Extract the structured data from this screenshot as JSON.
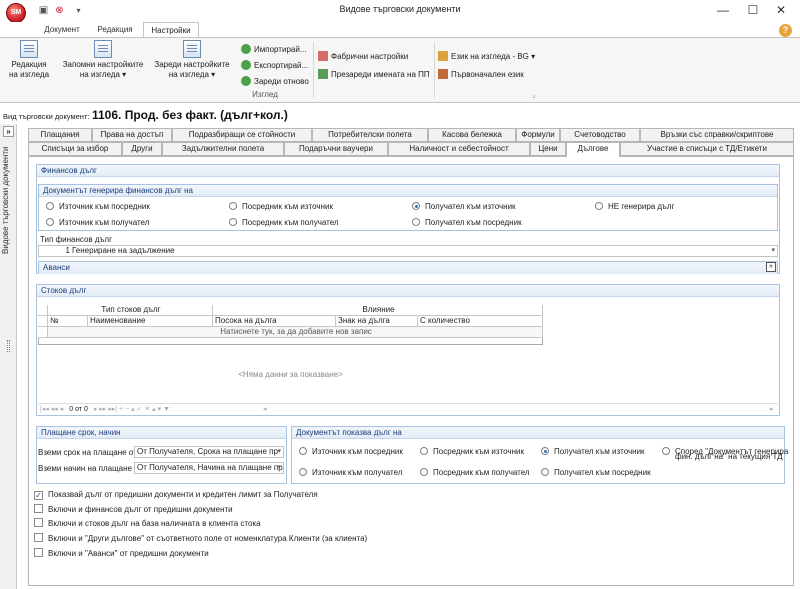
{
  "app": {
    "title": "Видове търговски документи",
    "orb_label": "SM"
  },
  "window": {
    "minimize": "—",
    "maximize": "☐",
    "close": "✕"
  },
  "ribbon": {
    "tabs": [
      "Документ",
      "Редакция",
      "Настройки"
    ],
    "active_tab": "Настройки",
    "buttons": {
      "edit_view": [
        "Редакция",
        "на изгледа"
      ],
      "save_settings": [
        "Запомни настройките",
        "на изгледа ▾"
      ],
      "load_settings": [
        "Зареди настройките",
        "на изгледа ▾"
      ],
      "import": "Импортирай...",
      "export": "Експортирай...",
      "reload": "Зареди отново",
      "factory": "Фабрични настройки",
      "reload_names": "Презареди имената на ПП",
      "language": "Език на изгледа - BG ▾",
      "original_language": "Първоначален език"
    },
    "group_label": "Изглед"
  },
  "doc": {
    "label": "Вид търговски документ:",
    "value": "1106. Прод. без факт. (дълг+кол.)"
  },
  "sidebar": {
    "label": "Видове търговски документи",
    "toggle": "»"
  },
  "tabs_row1": [
    "Плащания",
    "Права на достъп",
    "Подразбиращи се стойности",
    "Потребителски полета",
    "Касова бележка",
    "Формули",
    "Счетоводство",
    "Връзки със справки/скриптове"
  ],
  "tabs_row2": [
    "Списъци за избор",
    "Други",
    "Задължителни полета",
    "Подаръчни ваучери",
    "Наличност и себестойност",
    "Цени",
    "Дългове",
    "Участие в списъци с ТД/Етикети"
  ],
  "active_tab": "Дългове",
  "financial": {
    "title": "Финансов дълг",
    "source_title": "Документът генерира финансов дълг на",
    "options": [
      {
        "label": "Източник към посредник",
        "selected": false
      },
      {
        "label": "Посредник към източник",
        "selected": false
      },
      {
        "label": "Получател към източник",
        "selected": true
      },
      {
        "label": "НЕ генерира дълг",
        "selected": false
      },
      {
        "label": "Източник към получател",
        "selected": false
      },
      {
        "label": "Посредник към получател",
        "selected": false
      },
      {
        "label": "Получател към посредник",
        "selected": false
      }
    ],
    "type_label": "Тип финансов дълг",
    "type_num": "1",
    "type_value": "Генериране на задължение",
    "advances": "Аванси"
  },
  "stock": {
    "title": "Стоков дълг",
    "col_group1": "Тип стоков дълг",
    "col_group2": "Влияние",
    "cols": [
      "№",
      "Наименование",
      "Посока на дълга",
      "Знак на дълга",
      "С количество"
    ],
    "add_row": "Натиснете тук, за да добавите нов запис",
    "empty": "<Няма данни за показване>",
    "pager": "0 от 0"
  },
  "payment": {
    "title": "Плащане срок, начин",
    "term_label": "Вземи срок на плащане от",
    "term_value": "От Получателя, Срока на плащане пр",
    "method_label": "Вземи начин на плащане от",
    "method_value": "От Получателя, Начина на плащане пр"
  },
  "shows": {
    "title": "Документът показва дълг на",
    "options": [
      {
        "label": "Източник към посредник",
        "selected": false
      },
      {
        "label": "Посредник към източник",
        "selected": false
      },
      {
        "label": "Получател към източник",
        "selected": true
      },
      {
        "label": "Според \"Документът генерира",
        "label2": "фин. дълг на\" на текущия ТД",
        "selected": false
      },
      {
        "label": "Източник към получател",
        "selected": false
      },
      {
        "label": "Посредник към получател",
        "selected": false
      },
      {
        "label": "Получател към посредник",
        "selected": false
      }
    ]
  },
  "checkboxes": [
    {
      "label": "Показвай дълг от предишни документи и кредитен лимит за Получателя",
      "checked": true
    },
    {
      "label": "Включи и финансов дълг от предишни документи",
      "checked": false
    },
    {
      "label": "Включи и стоков дълг на база наличната в клиента стока",
      "checked": false
    },
    {
      "label": "Включи и \"Други дългове\" от съответното поле от номенклатура Клиенти (за клиента)",
      "checked": false
    },
    {
      "label": "Включи и \"Аванси\" от предишни документи",
      "checked": false
    }
  ]
}
